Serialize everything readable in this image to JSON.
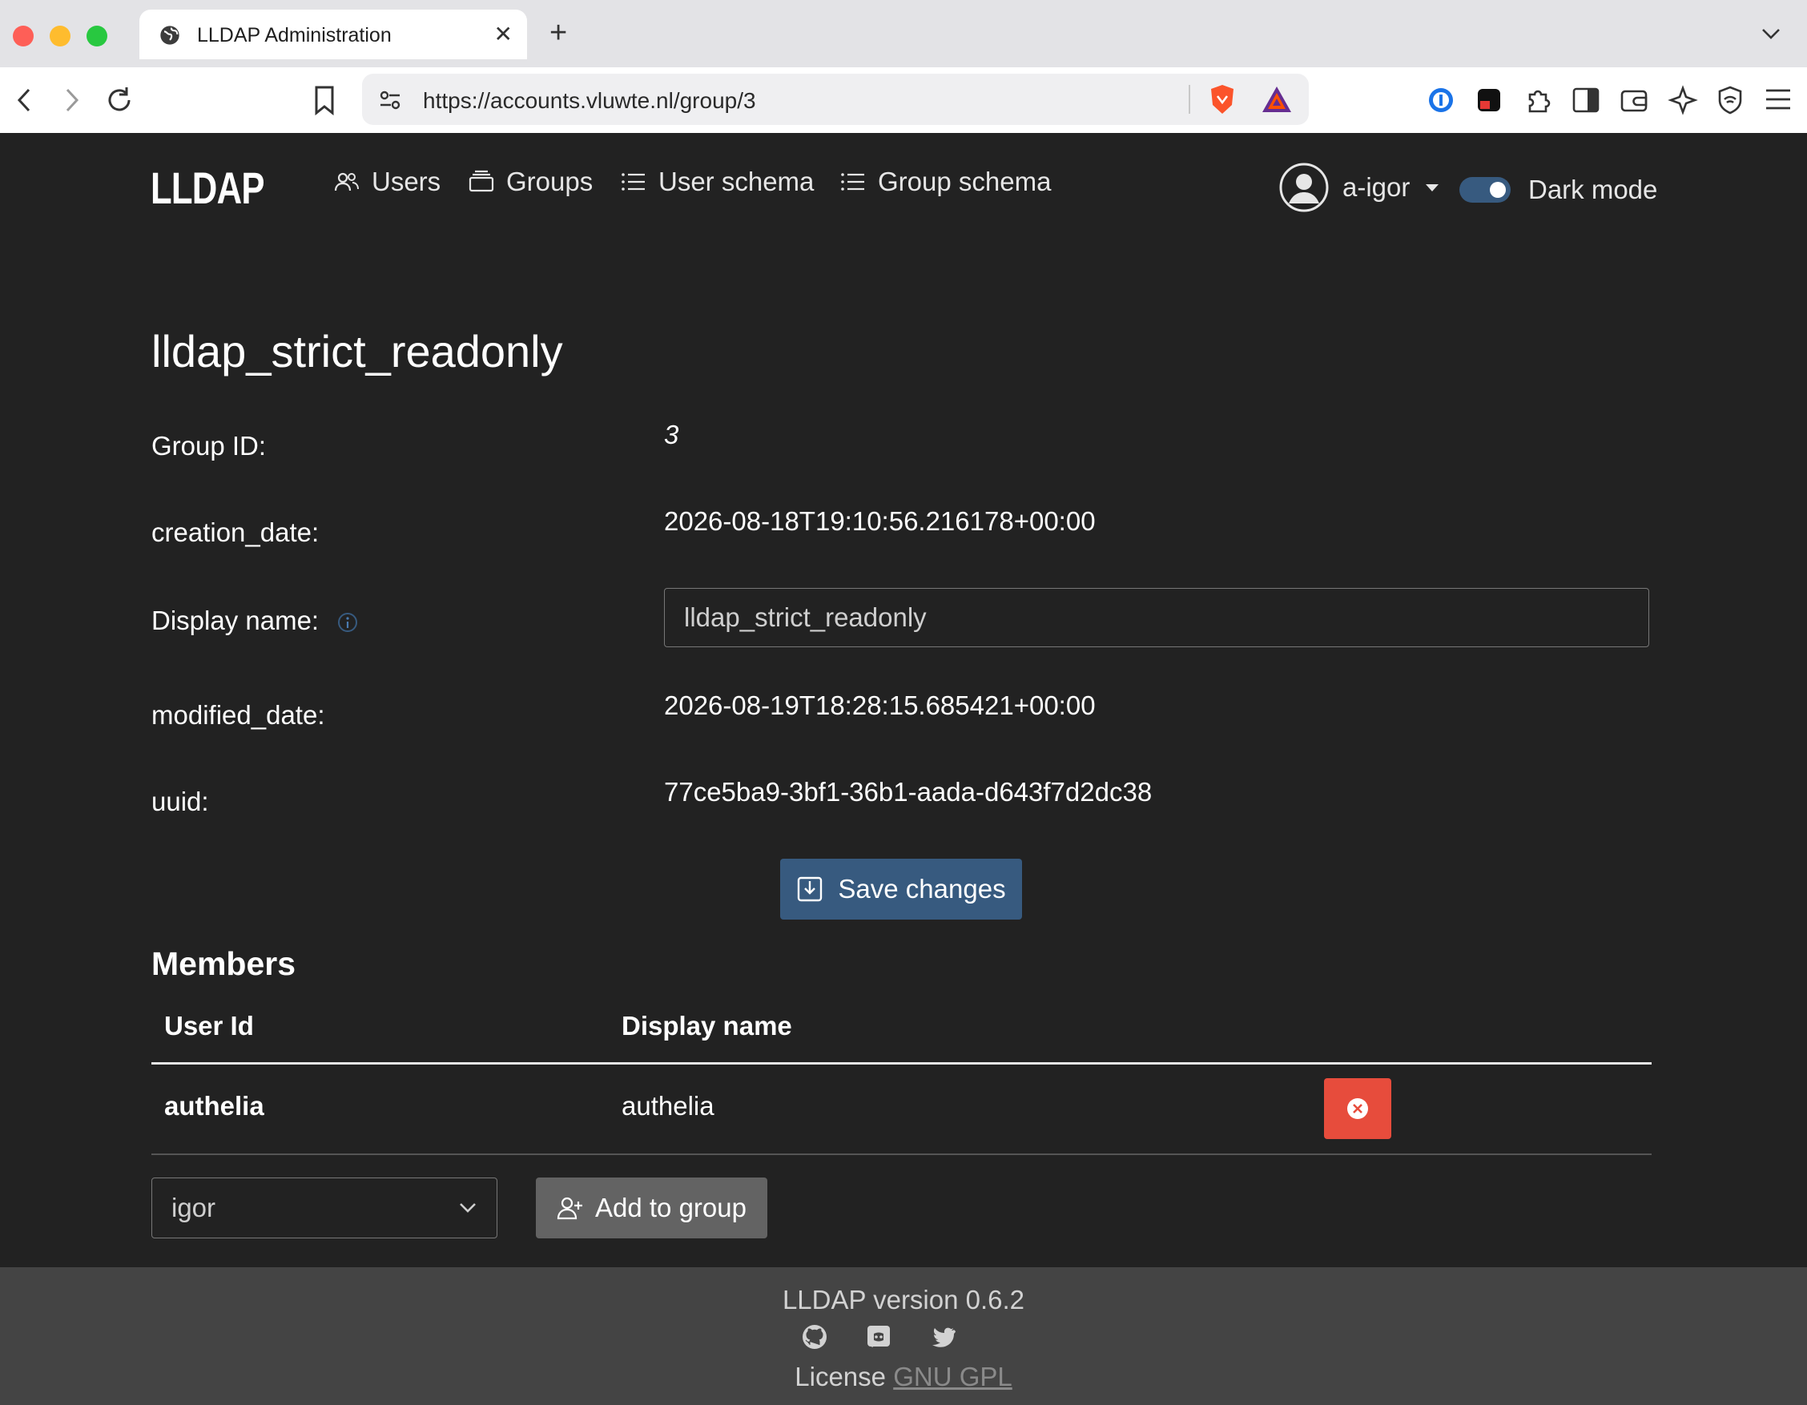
{
  "browser": {
    "tab_title": "LLDAP Administration",
    "url": "https://accounts.vluwte.nl/group/3"
  },
  "app": {
    "brand": "LLDAP",
    "nav": [
      {
        "label": "Users",
        "icon": "users-icon"
      },
      {
        "label": "Groups",
        "icon": "groups-icon"
      },
      {
        "label": "User schema",
        "icon": "list-icon"
      },
      {
        "label": "Group schema",
        "icon": "list-icon"
      }
    ],
    "user": "a-igor",
    "dark_mode_label": "Dark mode",
    "dark_mode_on": true
  },
  "group": {
    "title": "lldap_strict_readonly",
    "fields": [
      {
        "label": "Group ID:",
        "value": "3"
      },
      {
        "label": "creation_date:",
        "value": "2026-08-18T19:10:56.216178+00:00"
      },
      {
        "label": "Display name:",
        "value": "lldap_strict_readonly"
      },
      {
        "label": "modified_date:",
        "value": "2026-08-19T18:28:15.685421+00:00"
      },
      {
        "label": "uuid:",
        "value": "77ce5ba9-3bf1-36b1-aada-d643f7d2dc38"
      }
    ],
    "save_label": "Save changes"
  },
  "members": {
    "title": "Members",
    "columns": [
      "User Id",
      "Display name"
    ],
    "rows": [
      {
        "user_id": "authelia",
        "display_name": "authelia"
      }
    ],
    "select_value": "igor",
    "add_label": "Add to group"
  },
  "footer": {
    "version": "LLDAP version 0.6.2",
    "license_prefix": "License",
    "license_link": "GNU GPL"
  },
  "colors": {
    "background": "#222222",
    "primary": "#375a7f",
    "danger": "#e74c3c",
    "secondary": "#636363",
    "footer": "#444444"
  }
}
